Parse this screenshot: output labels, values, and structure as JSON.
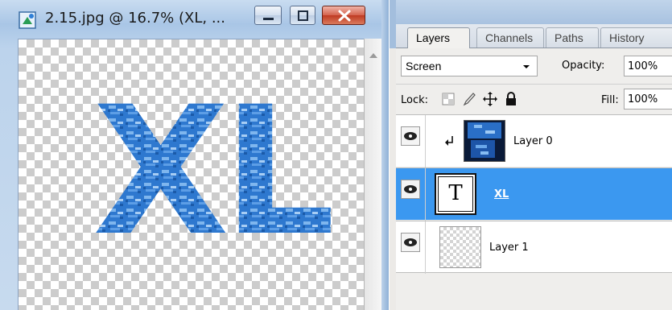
{
  "document_window": {
    "title": "2.15.jpg @ 16.7% (XL, ...",
    "canvas_text": "XL",
    "controls": {
      "minimize_icon": "minimize-icon",
      "maximize_icon": "maximize-icon",
      "close_icon": "close-icon"
    }
  },
  "layers_panel": {
    "tabs": [
      {
        "label": "Layers",
        "active": true
      },
      {
        "label": "Channels"
      },
      {
        "label": "Paths"
      },
      {
        "label": "History"
      }
    ],
    "blend_mode": "Screen",
    "opacity_label": "Opacity:",
    "opacity_value": "100%",
    "lock_label": "Lock:",
    "fill_label": "Fill:",
    "fill_value": "100%",
    "layers": [
      {
        "name": "Layer 0",
        "visible": true,
        "clipped": true,
        "thumbnail": "blue-texture"
      },
      {
        "name": "XL",
        "visible": true,
        "selected": true,
        "thumbnail_glyph": "T"
      },
      {
        "name": "Layer 1",
        "visible": true,
        "thumbnail": "transparent"
      }
    ]
  },
  "colors": {
    "selection": "#3b98f0",
    "xl_fill": "#2f7fd6",
    "window_chrome": "#a9c6e6"
  }
}
